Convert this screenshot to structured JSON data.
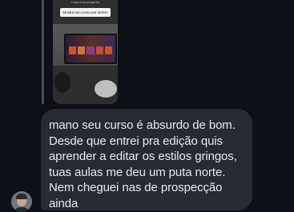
{
  "reply_preview": {
    "top_caption": "Faça uma pergunta",
    "question_text": "Mostra seu curso por dentro"
  },
  "message": {
    "text": "mano seu curso é absurdo de bom.\nDesde que entrei pra edição quis\naprender a editar os estilos gringos,\ntuas aulas me deu um puta norte.\nNem cheguei nas de prospecção\nainda"
  }
}
